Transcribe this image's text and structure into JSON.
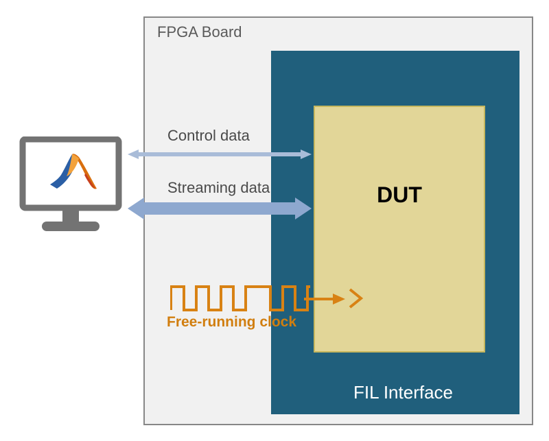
{
  "labels": {
    "fpga_board": "FPGA Board",
    "fil_interface": "FIL Interface",
    "dut": "DUT",
    "control_data": "Control data",
    "streaming_data": "Streaming data",
    "free_running_clock": "Free-running clock"
  },
  "colors": {
    "fpga_bg": "#f1f1f1",
    "fpga_border": "#878787",
    "fil_bg": "#205f7c",
    "dut_bg": "#e2d698",
    "dut_border": "#c6b75e",
    "arrow_blue": "#8ea8cf",
    "arrow_blue_light": "#b8c7de",
    "clock_orange": "#d88214",
    "monitor_gray": "#737373"
  }
}
